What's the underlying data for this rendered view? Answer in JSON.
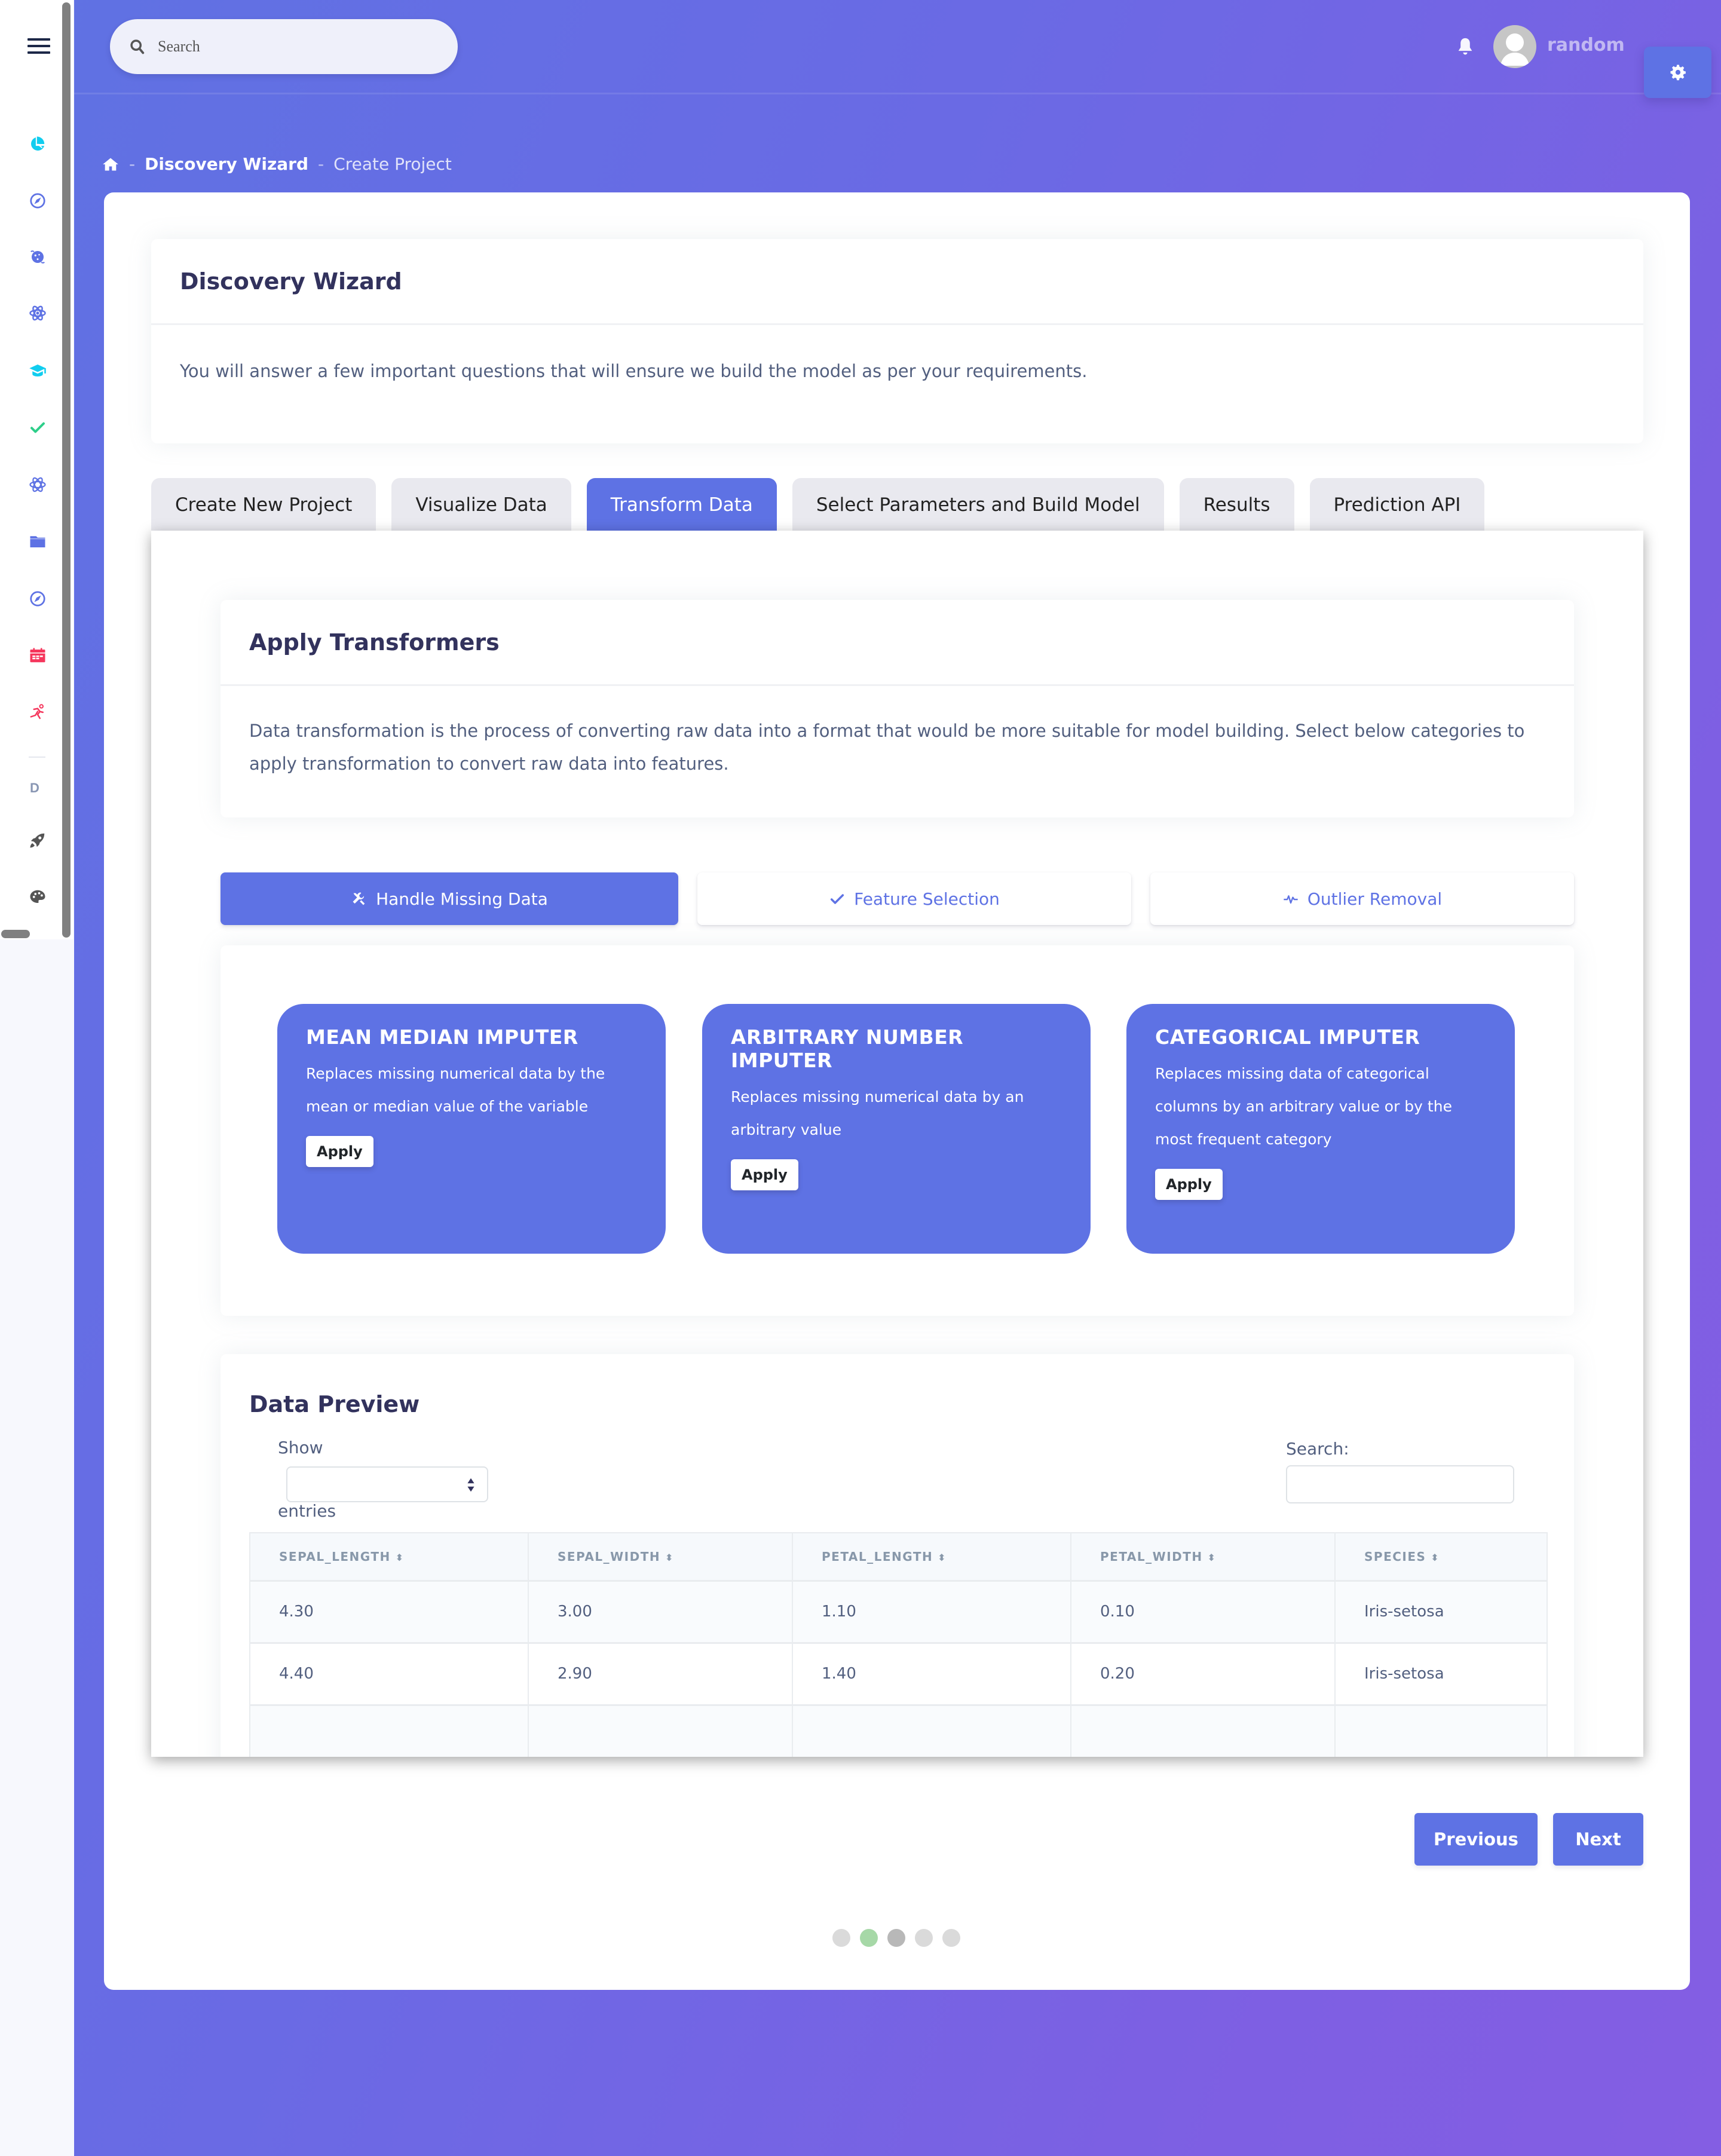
{
  "sidebar": {
    "menu_icon": "hamburger-icon",
    "items": [
      {
        "icon": "pie-chart-icon",
        "color": "#11cdef"
      },
      {
        "icon": "compass-icon",
        "color": "#5e72e4"
      },
      {
        "icon": "planet-icon",
        "color": "#5e72e4"
      },
      {
        "icon": "atom-icon",
        "color": "#5e72e4"
      },
      {
        "icon": "graduation-cap-icon",
        "color": "#11cdef"
      },
      {
        "icon": "check-icon",
        "color": "#2dce89"
      },
      {
        "icon": "atom-icon",
        "color": "#5e72e4"
      },
      {
        "icon": "folder-icon",
        "color": "#5e72e4"
      },
      {
        "icon": "compass-icon",
        "color": "#5e72e4"
      },
      {
        "icon": "calendar-icon",
        "color": "#f5365c"
      },
      {
        "icon": "running-icon",
        "color": "#f5365c"
      }
    ],
    "section_letter": "D",
    "extra_items": [
      {
        "icon": "rocket-icon",
        "color": "#555555"
      },
      {
        "icon": "palette-icon",
        "color": "#555555"
      }
    ]
  },
  "header": {
    "search_placeholder": "Search",
    "username": "random",
    "icons": [
      "bell-icon",
      "copy-icon",
      "avatar",
      "gear-icon"
    ]
  },
  "breadcrumb": {
    "home_icon": "home-icon",
    "items": [
      "Discovery Wizard",
      "Create Project"
    ]
  },
  "intro": {
    "title": "Discovery Wizard",
    "description": "You will answer a few important questions that will ensure we build the model as per your requirements."
  },
  "tabs": [
    {
      "label": "Create New Project",
      "active": false
    },
    {
      "label": "Visualize Data",
      "active": false
    },
    {
      "label": "Transform Data",
      "active": true
    },
    {
      "label": "Select Parameters and Build Model",
      "active": false
    },
    {
      "label": "Results",
      "active": false
    },
    {
      "label": "Prediction API",
      "active": false
    }
  ],
  "apply_transformers": {
    "title": "Apply Transformers",
    "description": "Data transformation is the process of converting raw data into a format that would be more suitable for model building. Select below categories to apply transformation to convert raw data into features."
  },
  "sub_nav": [
    {
      "label": "Handle Missing Data",
      "icon": "tools-icon",
      "active": true
    },
    {
      "label": "Feature Selection",
      "icon": "check-icon",
      "active": false
    },
    {
      "label": "Outlier Removal",
      "icon": "pulse-icon",
      "active": false
    }
  ],
  "imputers": [
    {
      "title": "MEAN MEDIAN IMPUTER",
      "description": "Replaces missing numerical data by the mean or median value of the variable",
      "button": "Apply"
    },
    {
      "title": "ARBITRARY NUMBER IMPUTER",
      "description": "Replaces missing numerical data by an arbitrary value",
      "button": "Apply"
    },
    {
      "title": "CATEGORICAL IMPUTER",
      "description": "Replaces missing data of categorical columns by an arbitrary value or by the most frequent category",
      "button": "Apply"
    }
  ],
  "data_preview": {
    "title": "Data Preview",
    "show_label": "Show",
    "entries_label": "entries",
    "length_selected": "",
    "search_label": "Search:",
    "search_value": "",
    "columns": [
      "SEPAL_LENGTH",
      "SEPAL_WIDTH",
      "PETAL_LENGTH",
      "PETAL_WIDTH",
      "SPECIES"
    ],
    "rows": [
      [
        "4.30",
        "3.00",
        "1.10",
        "0.10",
        "Iris-setosa"
      ],
      [
        "4.40",
        "2.90",
        "1.40",
        "0.20",
        "Iris-setosa"
      ],
      [
        "",
        "",
        "",
        "",
        ""
      ]
    ]
  },
  "wizard_nav": {
    "previous": "Previous",
    "next": "Next",
    "steps_total": 5,
    "step_states": [
      "default",
      "completed",
      "current",
      "default",
      "default"
    ],
    "step_colors": {
      "default": "#dadada",
      "completed": "#a6d8a7",
      "current": "#b8b8b8"
    }
  },
  "colors": {
    "primary": "#5e72e4",
    "heading": "#32325d",
    "body_text": "#525f7f"
  }
}
